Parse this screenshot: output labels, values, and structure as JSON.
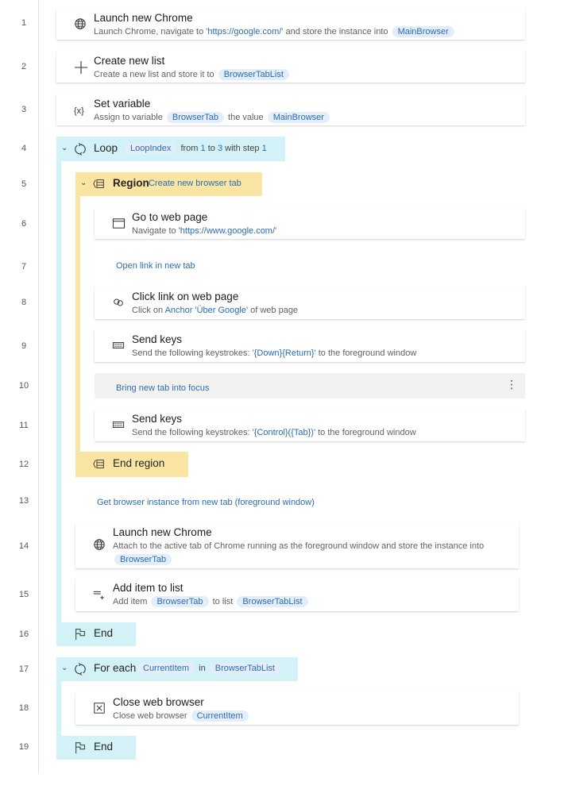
{
  "colors": {
    "loop": "#d3f2f8",
    "region": "#fbe5a2",
    "link": "#2b6cb0",
    "pill_bg": "#e4eefa",
    "comment_selected_bg": "#f3f2f1"
  },
  "rows": [
    {
      "line": "1",
      "kind": "action",
      "icon": "globe-icon",
      "title": "Launch new Chrome",
      "desc": [
        {
          "t": "Launch Chrome, navigate to "
        },
        {
          "l": "'https://google.com/'"
        },
        {
          "t": " and store the instance into "
        },
        {
          "v": "MainBrowser"
        }
      ]
    },
    {
      "line": "2",
      "kind": "action",
      "icon": "plus-icon",
      "title": "Create new list",
      "desc": [
        {
          "t": "Create a new list and store it to "
        },
        {
          "v": "BrowserTabList"
        }
      ]
    },
    {
      "line": "3",
      "kind": "action",
      "icon": "variable-icon",
      "title": "Set variable",
      "desc": [
        {
          "t": "Assign to variable "
        },
        {
          "v": "BrowserTab"
        },
        {
          "t": " the value "
        },
        {
          "v": "MainBrowser"
        }
      ]
    },
    {
      "line": "4",
      "kind": "loop",
      "icon": "loop-icon",
      "title": "Loop",
      "desc": [
        {
          "v": "LoopIndex"
        },
        {
          "t": " from "
        },
        {
          "l": "1"
        },
        {
          "t": " to "
        },
        {
          "l": "3"
        },
        {
          "t": " with step "
        },
        {
          "l": "1"
        }
      ]
    },
    {
      "line": "5",
      "kind": "region",
      "icon": "region-icon",
      "title": "Region",
      "desc": [
        {
          "l": "Create new browser tab"
        }
      ]
    },
    {
      "line": "6",
      "kind": "action",
      "icon": "webpage-icon",
      "title": "Go to web page",
      "desc": [
        {
          "t": "Navigate to "
        },
        {
          "l": "'https://www.google.com/'"
        }
      ]
    },
    {
      "line": "7",
      "kind": "comment",
      "title": "Open link in new tab"
    },
    {
      "line": "8",
      "kind": "action",
      "icon": "link-icon",
      "title": "Click link on web page",
      "desc": [
        {
          "t": "Click on "
        },
        {
          "l": "Anchor 'Über Google'"
        },
        {
          "t": " of web page"
        }
      ]
    },
    {
      "line": "9",
      "kind": "action",
      "icon": "keyboard-icon",
      "title": "Send keys",
      "desc": [
        {
          "t": "Send the following keystrokes: "
        },
        {
          "l": "'{Down}{Return}'"
        },
        {
          "t": " to the foreground window"
        }
      ]
    },
    {
      "line": "10",
      "kind": "comment-selected",
      "title": "Bring new tab into focus"
    },
    {
      "line": "11",
      "kind": "action",
      "icon": "keyboard-icon",
      "title": "Send keys",
      "desc": [
        {
          "t": "Send the following keystrokes: "
        },
        {
          "l": "'{Control}({Tab})'"
        },
        {
          "t": " to the foreground window"
        }
      ]
    },
    {
      "line": "12",
      "kind": "end-region",
      "icon": "region-icon",
      "title": "End region"
    },
    {
      "line": "13",
      "kind": "comment",
      "title": "Get browser instance from new tab (foreground window)"
    },
    {
      "line": "14",
      "kind": "action",
      "icon": "globe-icon",
      "title": "Launch new Chrome",
      "desc": [
        {
          "t": "Attach to the active tab of Chrome running as the foreground window and store the instance into "
        },
        {
          "v": "BrowserTab"
        }
      ]
    },
    {
      "line": "15",
      "kind": "action",
      "icon": "add-to-list-icon",
      "title": "Add item to list",
      "desc": [
        {
          "t": "Add item "
        },
        {
          "v": "BrowserTab"
        },
        {
          "t": " to list "
        },
        {
          "v": "BrowserTabList"
        }
      ]
    },
    {
      "line": "16",
      "kind": "end",
      "icon": "flag-icon",
      "title": "End"
    },
    {
      "line": "17",
      "kind": "loop",
      "icon": "loop-icon",
      "title": "For each",
      "desc": [
        {
          "v": "CurrentItem"
        },
        {
          "t": " in "
        },
        {
          "v": "BrowserTabList"
        }
      ]
    },
    {
      "line": "18",
      "kind": "action",
      "icon": "close-browser-icon",
      "title": "Close web browser",
      "desc": [
        {
          "t": "Close web browser "
        },
        {
          "v": "CurrentItem"
        }
      ]
    },
    {
      "line": "19",
      "kind": "end",
      "icon": "flag-icon",
      "title": "End"
    }
  ]
}
